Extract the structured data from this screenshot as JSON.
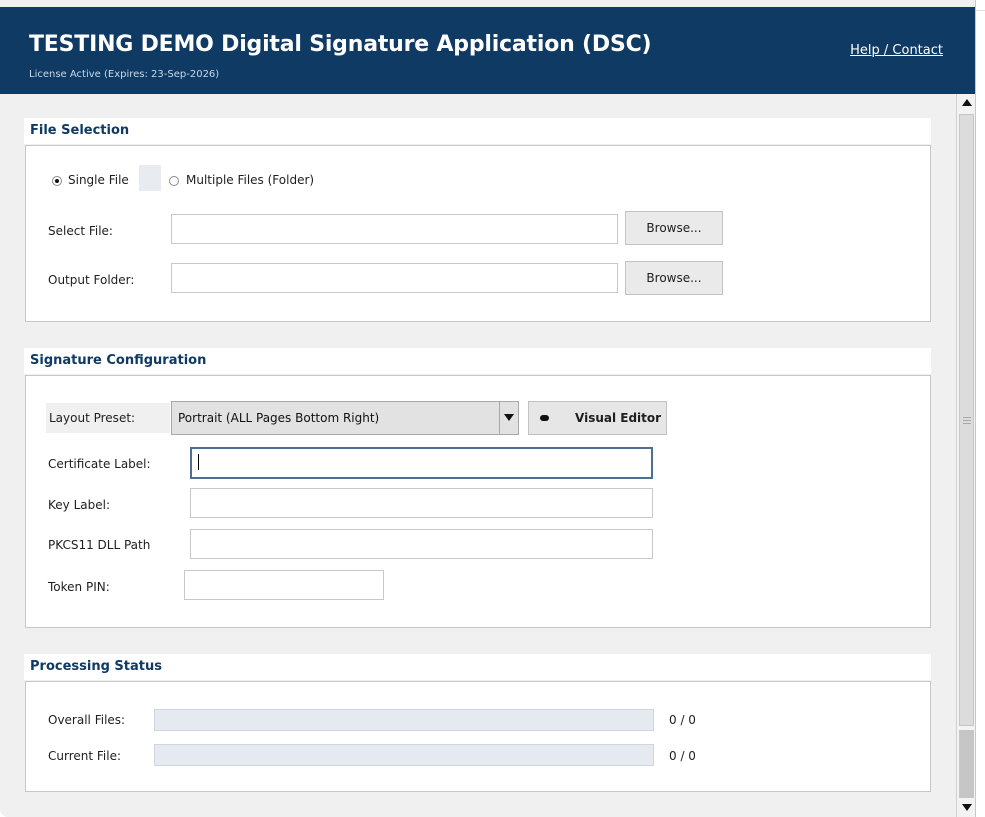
{
  "header": {
    "title": "TESTING DEMO Digital Signature Application (DSC)",
    "license": "License Active (Expires: 23-Sep-2026)",
    "help_link": "Help / Contact"
  },
  "file_selection": {
    "title": "File Selection",
    "mode_options": [
      "Single File",
      "Multiple Files (Folder)"
    ],
    "selected_mode": "Single File",
    "select_file_label": "Select File:",
    "select_file_value": "",
    "output_folder_label": "Output Folder:",
    "output_folder_value": "",
    "browse_label": "Browse..."
  },
  "signature_config": {
    "title": "Signature Configuration",
    "layout_preset_label": "Layout Preset:",
    "layout_preset_value": "Portrait (ALL Pages Bottom Right)",
    "visual_editor_label": "Visual Editor",
    "certificate_label": "Certificate Label:",
    "certificate_value": "",
    "key_label": "Key Label:",
    "key_value": "",
    "pkcs11_label": "PKCS11 DLL Path",
    "pkcs11_value": "",
    "token_pin_label": "Token PIN:",
    "token_pin_value": ""
  },
  "processing_status": {
    "title": "Processing Status",
    "overall_label": "Overall Files:",
    "overall_count": "0 / 0",
    "overall_progress": 0,
    "current_label": "Current File:",
    "current_count": "0 / 0",
    "current_progress": 0
  }
}
